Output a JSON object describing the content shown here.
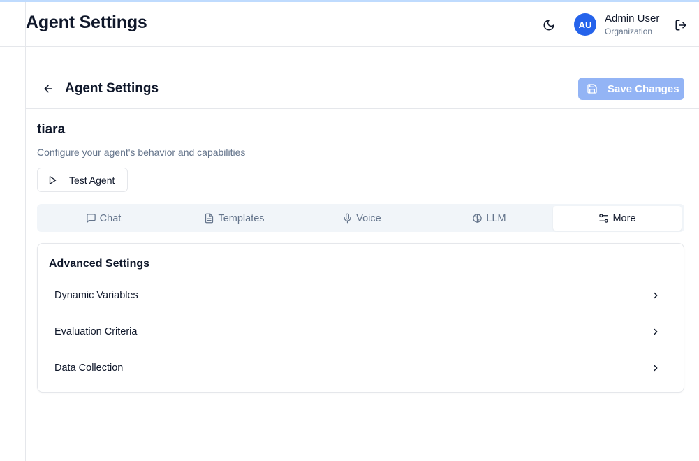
{
  "header": {
    "title": "Agent Settings",
    "user": {
      "initials": "AU",
      "name": "Admin User",
      "organization": "Organization"
    },
    "icons": {
      "theme": "moon-icon",
      "logout": "logout-icon"
    }
  },
  "page": {
    "title": "Agent Settings",
    "save_label": "Save Changes",
    "back_icon": "arrow-left-icon"
  },
  "agent": {
    "name": "tiara",
    "description": "Configure your agent's behavior and capabilities",
    "test_label": "Test Agent"
  },
  "tabs": [
    {
      "label": "Chat",
      "icon": "chat-icon",
      "active": false
    },
    {
      "label": "Templates",
      "icon": "document-icon",
      "active": false
    },
    {
      "label": "Voice",
      "icon": "microphone-icon",
      "active": false
    },
    {
      "label": "LLM",
      "icon": "brain-icon",
      "active": false
    },
    {
      "label": "More",
      "icon": "sliders-icon",
      "active": true
    }
  ],
  "advanced": {
    "title": "Advanced Settings",
    "items": [
      {
        "label": "Dynamic Variables"
      },
      {
        "label": "Evaluation Criteria"
      },
      {
        "label": "Data Collection"
      }
    ]
  },
  "colors": {
    "accent": "#2563eb",
    "save_button_disabled": "#93b4f5",
    "top_accent": "#bfdbfe"
  }
}
